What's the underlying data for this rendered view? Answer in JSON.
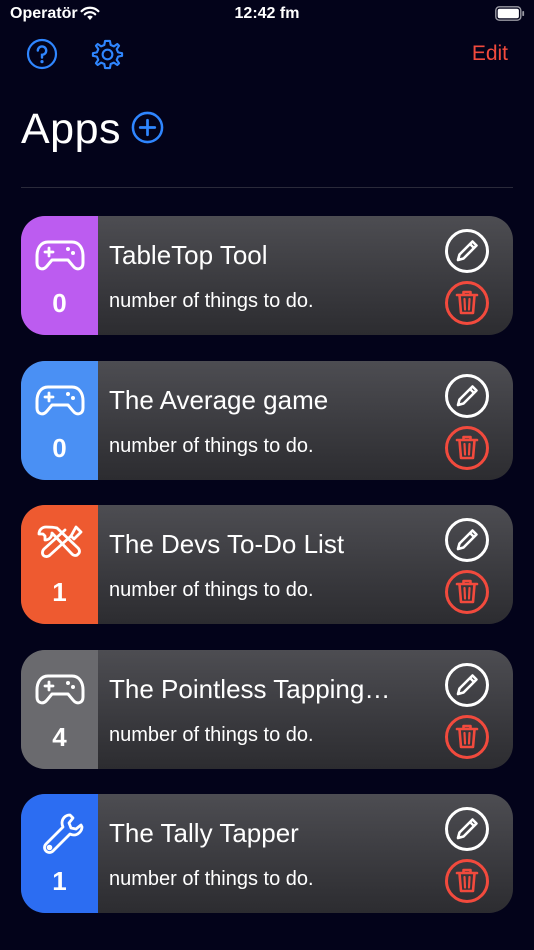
{
  "status": {
    "carrier": "Operatör",
    "time": "12:42 fm"
  },
  "nav": {
    "edit_label": "Edit"
  },
  "header": {
    "title": "Apps"
  },
  "colors": {
    "accent_blue": "#2f86ff",
    "destructive_red": "#f24a3d"
  },
  "apps": [
    {
      "title": "TableTop Tool",
      "subtitle": "number of things to do.",
      "count": "0",
      "icon": "gamepad-icon",
      "color": "#bc5cf0"
    },
    {
      "title": "The Average game",
      "subtitle": "number of things to do.",
      "count": "0",
      "icon": "gamepad-icon",
      "color": "#4a90f4"
    },
    {
      "title": "The Devs To-Do List",
      "subtitle": "number of things to do.",
      "count": "1",
      "icon": "tools-icon",
      "color": "#ee5a30"
    },
    {
      "title": "The Pointless Tapping…",
      "subtitle": "number of things to do.",
      "count": "4",
      "icon": "gamepad-icon",
      "color": "#6a6a6e"
    },
    {
      "title": "The Tally Tapper",
      "subtitle": "number of things to do.",
      "count": "1",
      "icon": "wrench-icon",
      "color": "#2c6df2"
    }
  ]
}
